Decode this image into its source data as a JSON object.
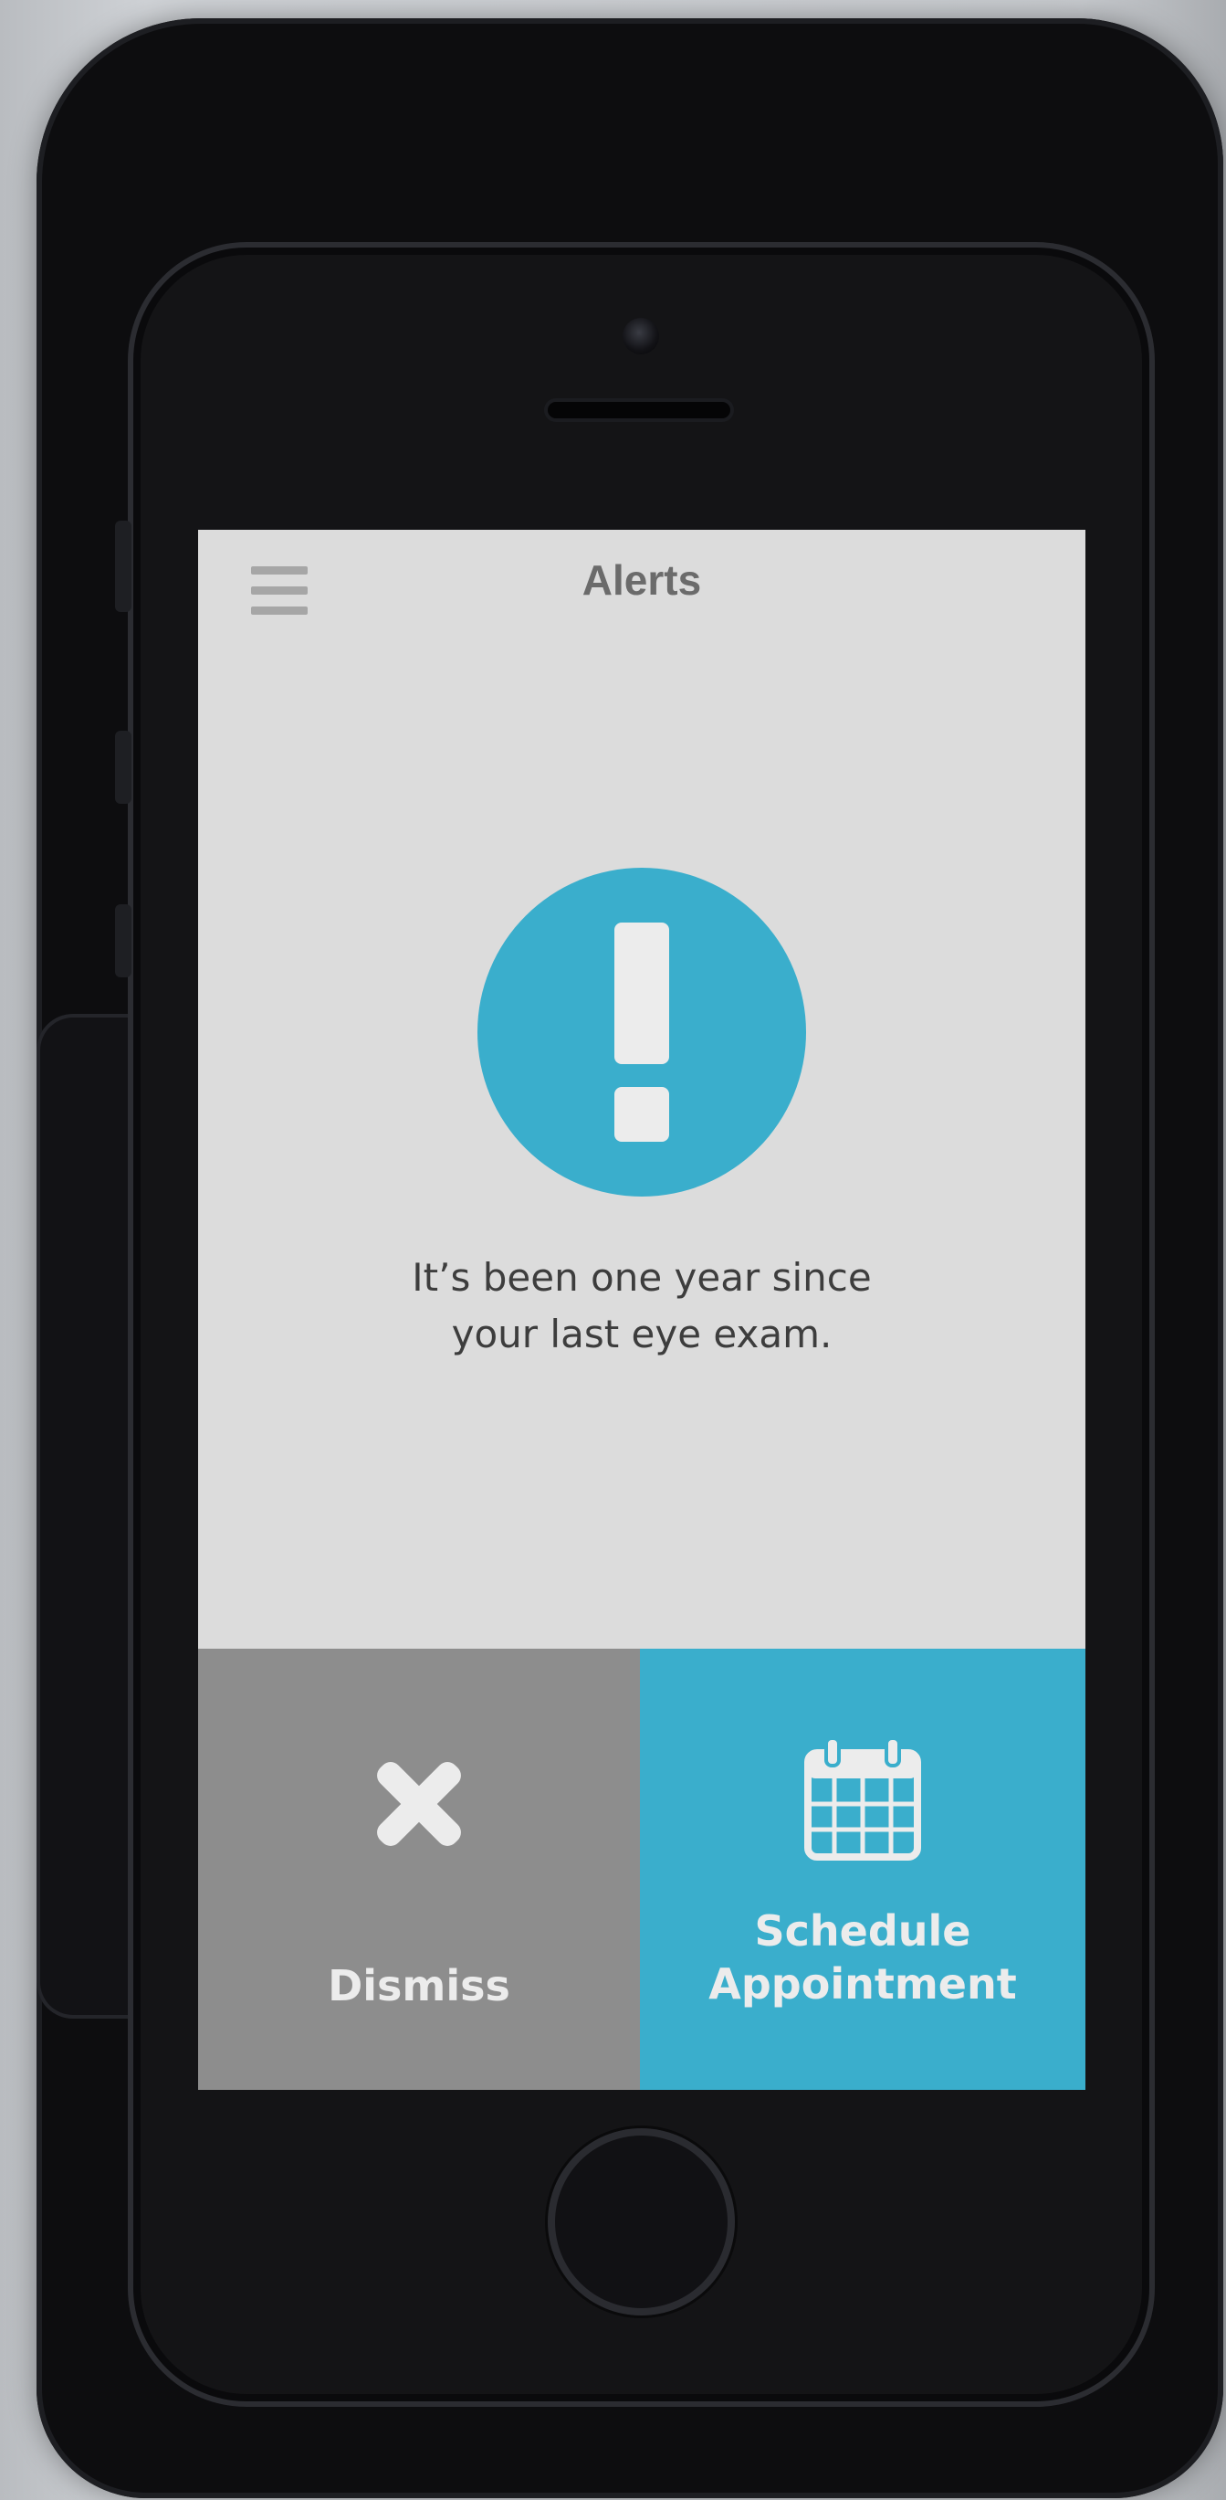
{
  "header": {
    "title": "Alerts",
    "menu_icon": "hamburger-menu-icon"
  },
  "alert": {
    "icon": "exclamation-icon",
    "message_line1": "It’s been one year since",
    "message_line2": "your last eye exam."
  },
  "actions": {
    "dismiss": {
      "label": "Dismiss",
      "icon": "close-x-icon"
    },
    "schedule": {
      "label_line1": "Schedule",
      "label_line2": "Appointment",
      "icon": "calendar-icon"
    }
  },
  "colors": {
    "accent": "#3aaecc",
    "dismiss_bg": "#8d8d8d",
    "screen_bg": "#dcdcdc",
    "title_text": "#6b6b6b",
    "body_text": "#3d3d3d"
  }
}
